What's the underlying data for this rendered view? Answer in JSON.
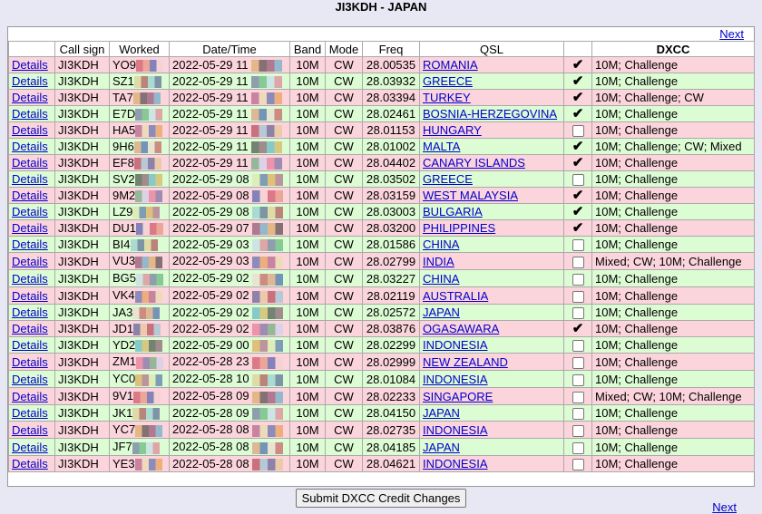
{
  "page_title": "JI3KDH - JAPAN",
  "nav": {
    "next_label": "Next"
  },
  "headers": {
    "details": "",
    "call_sign": "Call sign",
    "worked": "Worked",
    "datetime": "Date/Time",
    "band": "Band",
    "mode": "Mode",
    "freq": "Freq",
    "qsl": "QSL",
    "check": "",
    "dxcc": "DXCC"
  },
  "details_label": "Details",
  "rows": [
    {
      "call": "JI3KDH",
      "worked": "YO9",
      "date": "2022-05-29 11",
      "band": "10M",
      "mode": "CW",
      "freq": "28.00535",
      "qsl": "ROMANIA",
      "confirmed": true,
      "dxcc": "10M; Challenge",
      "color": "pink"
    },
    {
      "call": "JI3KDH",
      "worked": "SZ1",
      "date": "2022-05-29 11",
      "band": "10M",
      "mode": "CW",
      "freq": "28.03932",
      "qsl": "GREECE",
      "confirmed": true,
      "dxcc": "10M; Challenge",
      "color": "green"
    },
    {
      "call": "JI3KDH",
      "worked": "TA7",
      "date": "2022-05-29 11",
      "band": "10M",
      "mode": "CW",
      "freq": "28.03394",
      "qsl": "TURKEY",
      "confirmed": true,
      "dxcc": "10M; Challenge; CW",
      "color": "pink"
    },
    {
      "call": "JI3KDH",
      "worked": "E7D",
      "date": "2022-05-29 11",
      "band": "10M",
      "mode": "CW",
      "freq": "28.02461",
      "qsl": "BOSNIA-HERZEGOVINA",
      "confirmed": true,
      "dxcc": "10M; Challenge",
      "color": "green"
    },
    {
      "call": "JI3KDH",
      "worked": "HA5",
      "date": "2022-05-29 11",
      "band": "10M",
      "mode": "CW",
      "freq": "28.01153",
      "qsl": "HUNGARY",
      "confirmed": false,
      "dxcc": "10M; Challenge",
      "color": "pink"
    },
    {
      "call": "JI3KDH",
      "worked": "9H6",
      "date": "2022-05-29 11",
      "band": "10M",
      "mode": "CW",
      "freq": "28.01002",
      "qsl": "MALTA",
      "confirmed": true,
      "dxcc": "10M; Challenge; CW; Mixed",
      "color": "green"
    },
    {
      "call": "JI3KDH",
      "worked": "EF8",
      "date": "2022-05-29 11",
      "band": "10M",
      "mode": "CW",
      "freq": "28.04402",
      "qsl": "CANARY ISLANDS",
      "confirmed": true,
      "dxcc": "10M; Challenge",
      "color": "pink"
    },
    {
      "call": "JI3KDH",
      "worked": "SV2",
      "date": "2022-05-29 08",
      "band": "10M",
      "mode": "CW",
      "freq": "28.03502",
      "qsl": "GREECE",
      "confirmed": false,
      "dxcc": "10M; Challenge",
      "color": "green"
    },
    {
      "call": "JI3KDH",
      "worked": "9M2",
      "date": "2022-05-29 08",
      "band": "10M",
      "mode": "CW",
      "freq": "28.03159",
      "qsl": "WEST MALAYSIA",
      "confirmed": true,
      "dxcc": "10M; Challenge",
      "color": "pink"
    },
    {
      "call": "JI3KDH",
      "worked": "LZ9",
      "date": "2022-05-29 08",
      "band": "10M",
      "mode": "CW",
      "freq": "28.03003",
      "qsl": "BULGARIA",
      "confirmed": true,
      "dxcc": "10M; Challenge",
      "color": "green"
    },
    {
      "call": "JI3KDH",
      "worked": "DU1",
      "date": "2022-05-29 07",
      "band": "10M",
      "mode": "CW",
      "freq": "28.03200",
      "qsl": "PHILIPPINES",
      "confirmed": true,
      "dxcc": "10M; Challenge",
      "color": "pink"
    },
    {
      "call": "JI3KDH",
      "worked": "BI4",
      "date": "2022-05-29 03",
      "band": "10M",
      "mode": "CW",
      "freq": "28.01586",
      "qsl": "CHINA",
      "confirmed": false,
      "dxcc": "10M; Challenge",
      "color": "green"
    },
    {
      "call": "JI3KDH",
      "worked": "VU3",
      "date": "2022-05-29 03",
      "band": "10M",
      "mode": "CW",
      "freq": "28.02799",
      "qsl": "INDIA",
      "confirmed": false,
      "dxcc": "Mixed; CW; 10M; Challenge",
      "color": "pink",
      "tall": true
    },
    {
      "call": "JI3KDH",
      "worked": "BG5",
      "date": "2022-05-29 02",
      "band": "10M",
      "mode": "CW",
      "freq": "28.03227",
      "qsl": "CHINA",
      "confirmed": false,
      "dxcc": "10M; Challenge",
      "color": "green",
      "tall": true
    },
    {
      "call": "JI3KDH",
      "worked": "VK4",
      "date": "2022-05-29 02",
      "band": "10M",
      "mode": "CW",
      "freq": "28.02119",
      "qsl": "AUSTRALIA",
      "confirmed": false,
      "dxcc": "10M; Challenge",
      "color": "pink",
      "tall": true
    },
    {
      "call": "JI3KDH",
      "worked": "JA3",
      "date": "2022-05-29 02",
      "band": "10M",
      "mode": "CW",
      "freq": "28.02572",
      "qsl": "JAPAN",
      "confirmed": false,
      "dxcc": "10M; Challenge",
      "color": "green"
    },
    {
      "call": "JI3KDH",
      "worked": "JD1",
      "date": "2022-05-29 02",
      "band": "10M",
      "mode": "CW",
      "freq": "28.03876",
      "qsl": "OGASAWARA",
      "confirmed": true,
      "dxcc": "10M; Challenge",
      "color": "pink"
    },
    {
      "call": "JI3KDH",
      "worked": "YD2",
      "date": "2022-05-29 00",
      "band": "10M",
      "mode": "CW",
      "freq": "28.02299",
      "qsl": "INDONESIA",
      "confirmed": false,
      "dxcc": "10M; Challenge",
      "color": "green"
    },
    {
      "call": "JI3KDH",
      "worked": "ZM1",
      "date": "2022-05-28 23",
      "band": "10M",
      "mode": "CW",
      "freq": "28.02999",
      "qsl": "NEW ZEALAND",
      "confirmed": false,
      "dxcc": "10M; Challenge",
      "color": "pink",
      "tall": true
    },
    {
      "call": "JI3KDH",
      "worked": "YC0",
      "date": "2022-05-28 10",
      "band": "10M",
      "mode": "CW",
      "freq": "28.01084",
      "qsl": "INDONESIA",
      "confirmed": false,
      "dxcc": "10M; Challenge",
      "color": "green",
      "tall": true
    },
    {
      "call": "JI3KDH",
      "worked": "9V1",
      "date": "2022-05-28 09",
      "band": "10M",
      "mode": "CW",
      "freq": "28.02233",
      "qsl": "SINGAPORE",
      "confirmed": false,
      "dxcc": "Mixed; CW; 10M; Challenge",
      "color": "pink",
      "tall": true
    },
    {
      "call": "JI3KDH",
      "worked": "JK1",
      "date": "2022-05-28 09",
      "band": "10M",
      "mode": "CW",
      "freq": "28.04150",
      "qsl": "JAPAN",
      "confirmed": false,
      "dxcc": "10M; Challenge",
      "color": "green"
    },
    {
      "call": "JI3KDH",
      "worked": "YC7",
      "date": "2022-05-28 08",
      "band": "10M",
      "mode": "CW",
      "freq": "28.02735",
      "qsl": "INDONESIA",
      "confirmed": false,
      "dxcc": "10M; Challenge",
      "color": "pink",
      "tall": true
    },
    {
      "call": "JI3KDH",
      "worked": "JF7",
      "date": "2022-05-28 08",
      "band": "10M",
      "mode": "CW",
      "freq": "28.04185",
      "qsl": "JAPAN",
      "confirmed": false,
      "dxcc": "10M; Challenge",
      "color": "green",
      "tall": true
    },
    {
      "call": "JI3KDH",
      "worked": "YE3",
      "date": "2022-05-28 08",
      "band": "10M",
      "mode": "CW",
      "freq": "28.04621",
      "qsl": "INDONESIA",
      "confirmed": false,
      "dxcc": "10M; Challenge",
      "color": "pink"
    }
  ],
  "submit_label": "Submit DXCC Credit Changes",
  "colors": {
    "pink_row": "#fcd4dc",
    "green_row": "#dcfcd4",
    "link": "#0000cc"
  }
}
